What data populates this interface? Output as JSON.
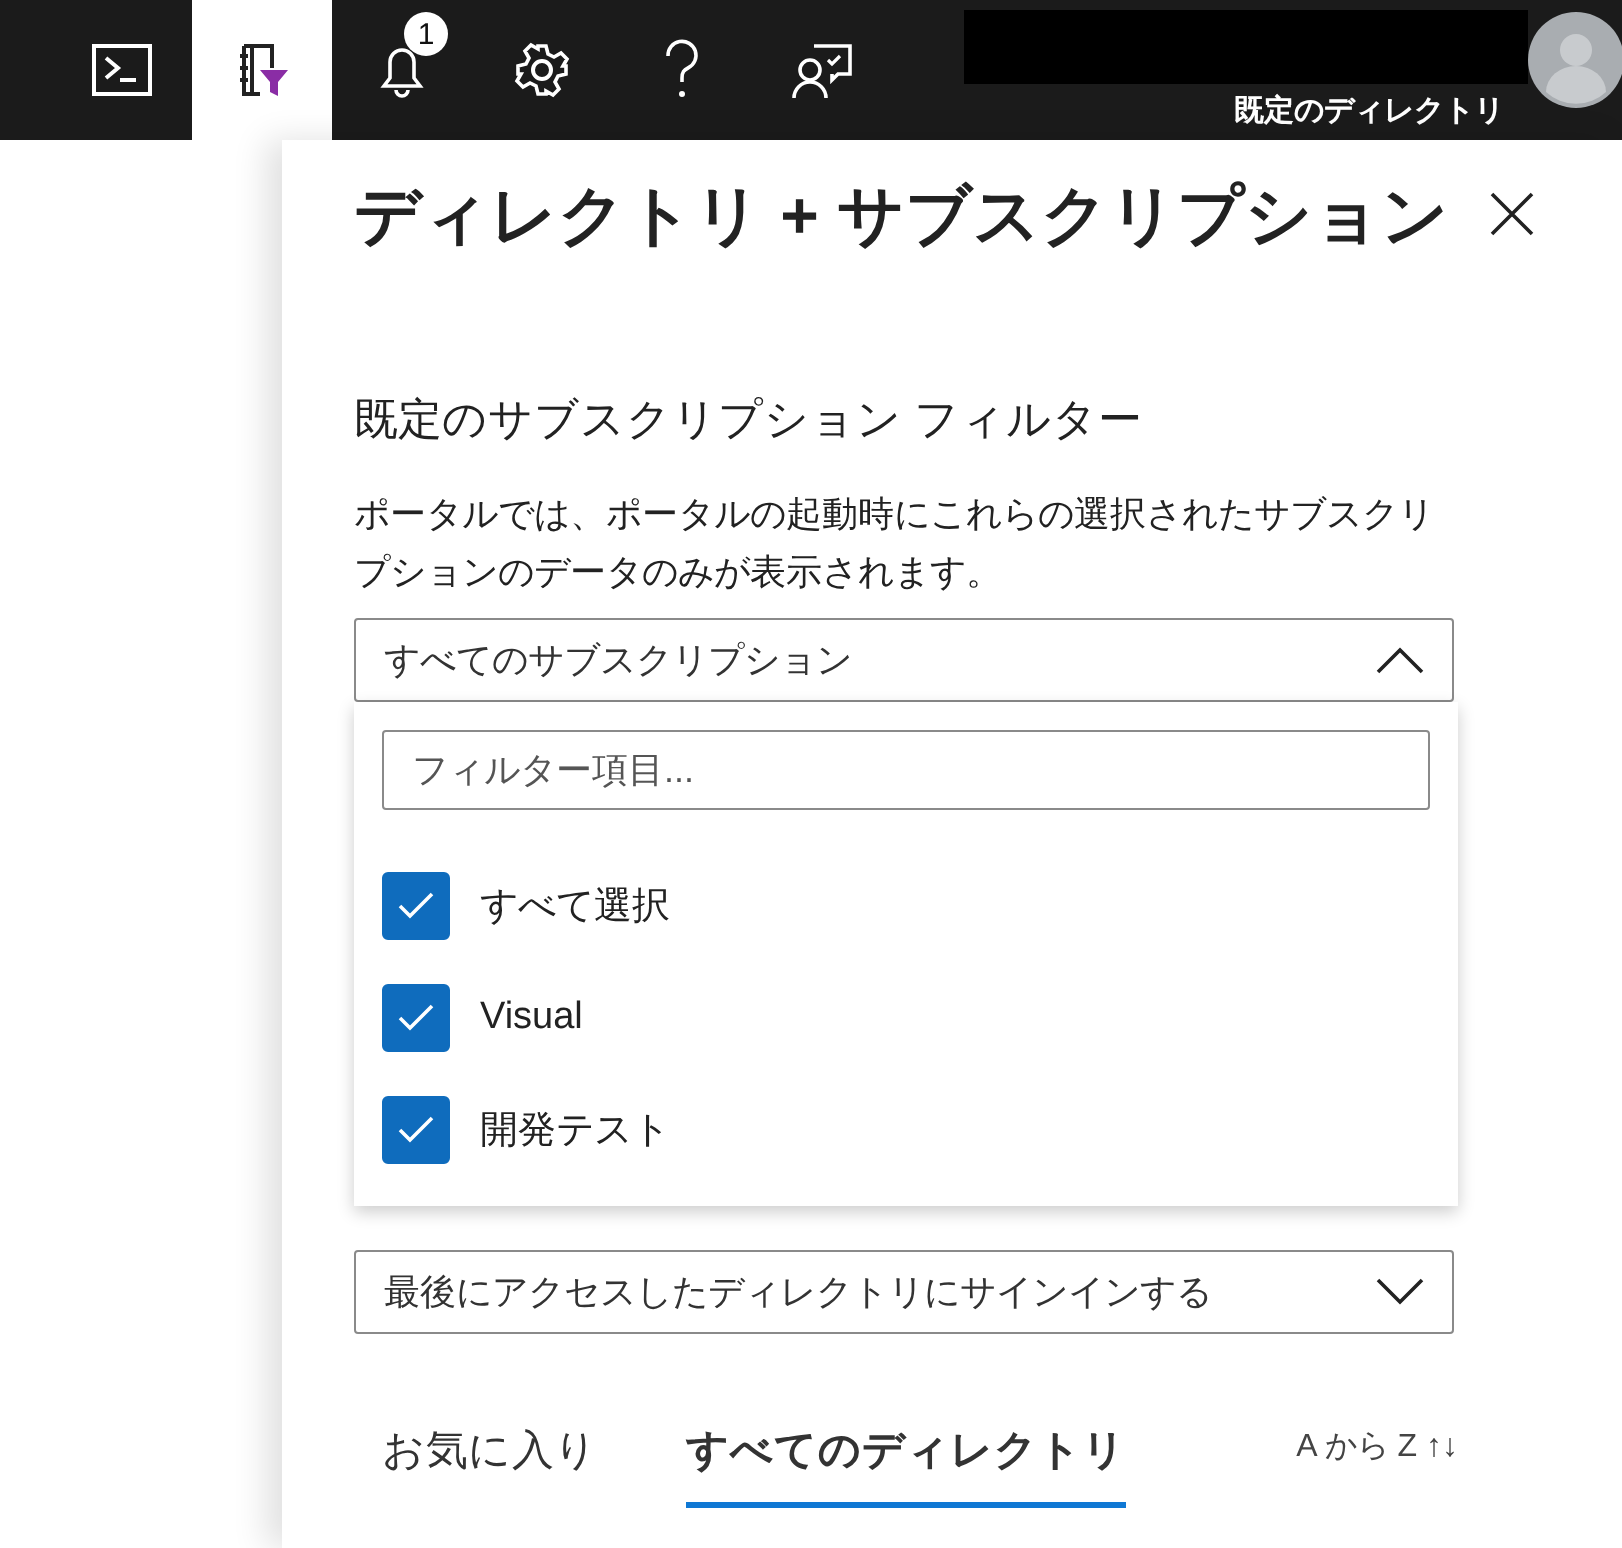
{
  "topbar": {
    "icons": [
      {
        "kind": "terminal",
        "selected": false
      },
      {
        "kind": "filter",
        "selected": true
      },
      {
        "kind": "bell",
        "selected": false,
        "badge": "1"
      },
      {
        "kind": "gear",
        "selected": false
      },
      {
        "kind": "help",
        "selected": false
      },
      {
        "kind": "feedback",
        "selected": false
      }
    ],
    "directory": "既定のディレクトリ"
  },
  "panel": {
    "title": "ディレクトリ + サブスクリプション",
    "section_title": "既定のサブスクリプション フィルター",
    "description": "ポータルでは、ポータルの起動時にこれらの選択されたサブスクリプションのデータのみが表示されます。",
    "subscription_dropdown": {
      "value": "すべてのサブスクリプション",
      "expanded": true,
      "filter_placeholder": "フィルター項目...",
      "options": [
        {
          "label": "すべて選択",
          "checked": true
        },
        {
          "label": "Visual",
          "checked": true
        },
        {
          "label": "開発テスト",
          "checked": true
        }
      ]
    },
    "directory_dropdown": {
      "value": "最後にアクセスしたディレクトリにサインインする",
      "expanded": false
    },
    "tabs": [
      {
        "label": "お気に入り",
        "selected": false
      },
      {
        "label": "すべてのディレクトリ",
        "selected": true
      }
    ],
    "sort": "A から Z ↑↓"
  }
}
